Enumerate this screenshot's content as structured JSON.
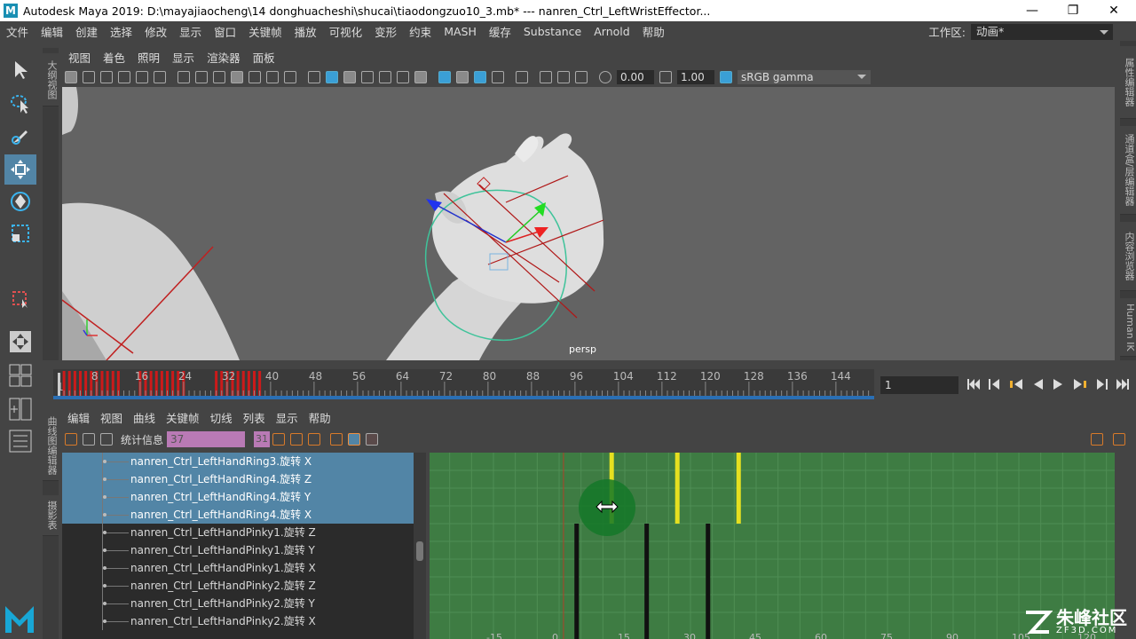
{
  "titlebar": {
    "title": "Autodesk Maya 2019: D:\\mayajiaocheng\\14 donghuacheshi\\shucai\\tiaodongzuo10_3.mb*   ---   nanren_Ctrl_LeftWristEffector...",
    "minimize": "—",
    "maximize": "❐",
    "close": "✕"
  },
  "menubar": {
    "items": [
      "文件",
      "编辑",
      "创建",
      "选择",
      "修改",
      "显示",
      "窗口",
      "关键帧",
      "播放",
      "可视化",
      "变形",
      "约束",
      "MASH",
      "缓存",
      "Substance",
      "Arnold",
      "帮助"
    ]
  },
  "workspace": {
    "label": "工作区:",
    "value": "动画*"
  },
  "left_tabs": {
    "outliner": "大纲视图",
    "graph_editor": "曲线图编辑器",
    "dope_sheet": "摄影表"
  },
  "right_tabs": [
    "属性编辑器",
    "通道盒/层编辑器",
    "内容浏览器",
    "Human IK"
  ],
  "viewport": {
    "menu": [
      "视图",
      "着色",
      "照明",
      "显示",
      "渲染器",
      "面板"
    ],
    "exposure": "0.00",
    "gamma": "1.00",
    "colorspace": "sRGB gamma",
    "camera_label": "persp"
  },
  "timeline": {
    "ticks": [
      "1",
      "8",
      "16",
      "24",
      "32",
      "40",
      "48",
      "56",
      "64",
      "72",
      "80",
      "88",
      "96",
      "104",
      "112",
      "120",
      "128",
      "136",
      "144"
    ],
    "current_frame": "1"
  },
  "dopesheet": {
    "menu": [
      "编辑",
      "视图",
      "曲线",
      "关键帧",
      "切线",
      "列表",
      "显示",
      "帮助"
    ],
    "stats_label": "统计信息",
    "stats_value": "37",
    "stats_value2": "31",
    "rows": [
      {
        "label": "nanren_Ctrl_LeftHandRing3.旋转 X",
        "selected": true
      },
      {
        "label": "nanren_Ctrl_LeftHandRing4.旋转 Z",
        "selected": true
      },
      {
        "label": "nanren_Ctrl_LeftHandRing4.旋转 Y",
        "selected": true
      },
      {
        "label": "nanren_Ctrl_LeftHandRing4.旋转 X",
        "selected": true
      },
      {
        "label": "nanren_Ctrl_LeftHandPinky1.旋转 Z",
        "selected": false
      },
      {
        "label": "nanren_Ctrl_LeftHandPinky1.旋转 Y",
        "selected": false
      },
      {
        "label": "nanren_Ctrl_LeftHandPinky1.旋转 X",
        "selected": false
      },
      {
        "label": "nanren_Ctrl_LeftHandPinky2.旋转 Z",
        "selected": false
      },
      {
        "label": "nanren_Ctrl_LeftHandPinky2.旋转 Y",
        "selected": false
      },
      {
        "label": "nanren_Ctrl_LeftHandPinky2.旋转 X",
        "selected": false
      }
    ],
    "graph_ticks": [
      "-15",
      "0",
      "15",
      "30",
      "45",
      "60",
      "75",
      "90",
      "105",
      "120"
    ]
  },
  "watermark": {
    "brand": "朱峰社区",
    "url": "ZF3D.COM"
  }
}
